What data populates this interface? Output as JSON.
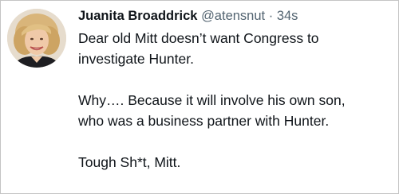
{
  "tweet": {
    "display_name": "Juanita Broaddrick",
    "handle": "@atensnut",
    "separator": "·",
    "timestamp": "34s",
    "text_lines": [
      "Dear old Mitt doesn’t want Congress to",
      "investigate Hunter.",
      "Why…. Because it will involve his own son,",
      "who was a business partner with Hunter.",
      "Tough Sh*t, Mitt."
    ]
  }
}
